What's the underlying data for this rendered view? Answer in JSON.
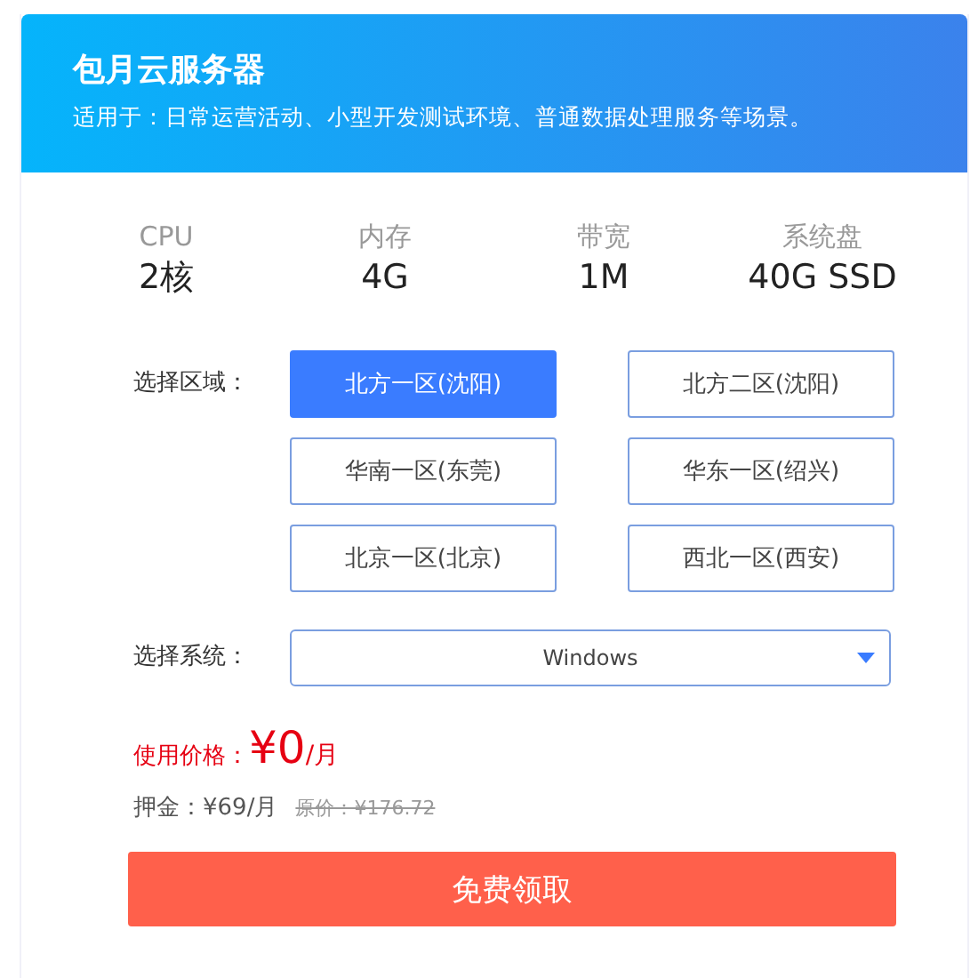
{
  "header": {
    "title": "包月云服务器",
    "subtitle": "适用于：日常运营活动、小型开发测试环境、普通数据处理服务等场景。"
  },
  "specs": [
    {
      "label": "CPU",
      "value": "2核"
    },
    {
      "label": "内存",
      "value": "4G"
    },
    {
      "label": "带宽",
      "value": "1M"
    },
    {
      "label": "系统盘",
      "value": "40G SSD"
    }
  ],
  "region": {
    "label": "选择区域：",
    "options": [
      {
        "label": "北方一区(沈阳)",
        "selected": true
      },
      {
        "label": "北方二区(沈阳)",
        "selected": false
      },
      {
        "label": "华南一区(东莞)",
        "selected": false
      },
      {
        "label": "华东一区(绍兴)",
        "selected": false
      },
      {
        "label": "北京一区(北京)",
        "selected": false
      },
      {
        "label": "西北一区(西安)",
        "selected": false
      }
    ]
  },
  "system": {
    "label": "选择系统：",
    "value": "Windows"
  },
  "price": {
    "label": "使用价格：",
    "amount": "¥0",
    "unit": "/月"
  },
  "deposit": {
    "text": "押金：¥69/月",
    "original": "原价：¥176.72"
  },
  "action": "免费领取"
}
